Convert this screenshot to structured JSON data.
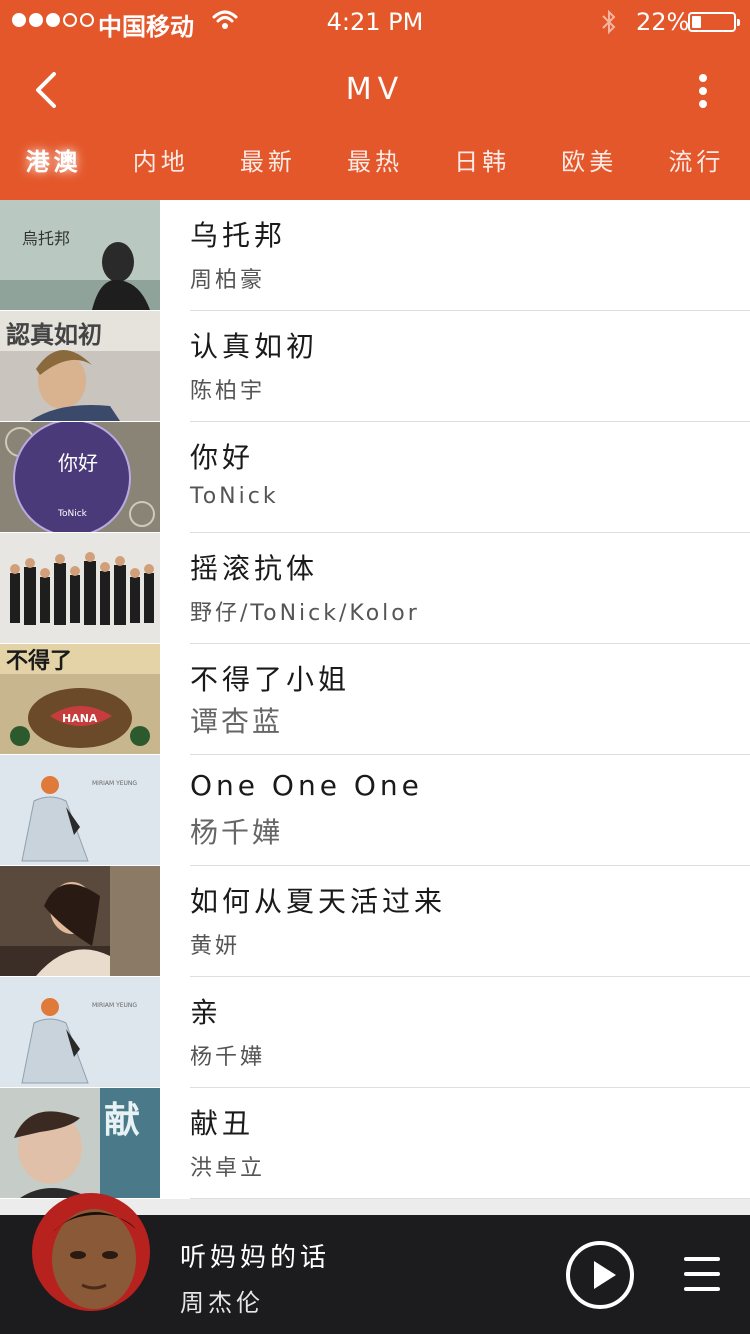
{
  "status_bar": {
    "carrier": "中国移动",
    "time": "4:21 PM",
    "battery_percent": "22%",
    "battery_level": 0.22,
    "signal_bars_filled": 3,
    "signal_bars_total": 5
  },
  "nav": {
    "title": "MV",
    "back_icon": "chevron-left-icon",
    "more_icon": "more-vertical-icon"
  },
  "tabs": [
    {
      "label": "港澳",
      "active": true
    },
    {
      "label": "内地",
      "active": false
    },
    {
      "label": "最新",
      "active": false
    },
    {
      "label": "最热",
      "active": false
    },
    {
      "label": "日韩",
      "active": false
    },
    {
      "label": "欧美",
      "active": false
    },
    {
      "label": "流行",
      "active": false
    }
  ],
  "list": {
    "items": [
      {
        "title": "乌托邦",
        "artist": "周柏豪",
        "thumb_text": "烏托邦"
      },
      {
        "title": "认真如初",
        "artist": "陈柏宇",
        "thumb_text": "認真如初"
      },
      {
        "title": "你好",
        "artist": "ToNick",
        "thumb_text": "你好"
      },
      {
        "title": "摇滚抗体",
        "artist": "野仔/ToNick/Kolor",
        "thumb_text": ""
      },
      {
        "title": "不得了小姐",
        "artist": "谭杏蓝",
        "thumb_text": "不得了"
      },
      {
        "title": "One One One",
        "artist": "杨千嬅",
        "thumb_text": ""
      },
      {
        "title": "如何从夏天活过来",
        "artist": "黄妍",
        "thumb_text": ""
      },
      {
        "title": "亲",
        "artist": "杨千嬅",
        "thumb_text": ""
      },
      {
        "title": "献丑",
        "artist": "洪卓立",
        "thumb_text": "献"
      }
    ]
  },
  "player": {
    "title": "听妈妈的话",
    "artist": "周杰伦",
    "play_icon": "play-icon",
    "playlist_icon": "playlist-icon"
  },
  "colors": {
    "accent": "#e4572a",
    "player_bg": "#1c1c1e"
  }
}
